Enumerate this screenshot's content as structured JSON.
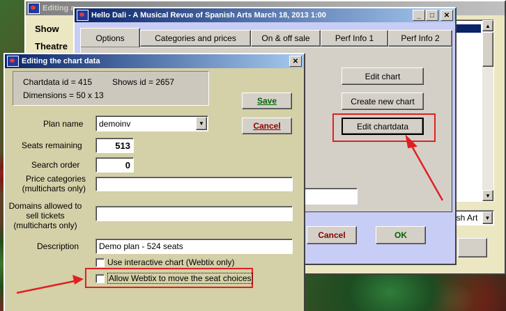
{
  "back_window": {
    "title": "Editing a...",
    "sidebar_items": [
      "Show",
      "Theatre"
    ],
    "dropdown_value": "ish Art"
  },
  "middle_window": {
    "title": "Hello Dali - A Musical Revue of Spanish Arts March 18, 2013 1:00",
    "tabs": [
      "Options",
      "Categories and prices",
      "On & off sale",
      "Perf Info 1",
      "Perf Info 2"
    ],
    "buttons": {
      "edit_chart": "Edit chart",
      "create_new_chart": "Create new chart",
      "edit_chartdata": "Edit chartdata",
      "cancel": "Cancel",
      "ok": "OK"
    }
  },
  "front_window": {
    "title": "Editing the chart data",
    "info": {
      "chartdata_id": "Chartdata id = 415",
      "shows_id": "Shows id = 2657",
      "dimensions": "Dimensions = 50 x 13"
    },
    "labels": {
      "plan_name": "Plan name",
      "seats_remaining": "Seats remaining",
      "search_order": "Search order",
      "price_categories_1": "Price categories",
      "price_categories_2": "(multicharts only)",
      "domains_1": "Domains allowed  to",
      "domains_2": "sell tickets",
      "domains_3": "(multicharts only)",
      "description": "Description"
    },
    "values": {
      "plan_name": "demoinv",
      "seats_remaining": "513",
      "search_order": "0",
      "price_categories": "",
      "domains": "",
      "description": "Demo plan - 524 seats"
    },
    "checkboxes": {
      "interactive_chart": "Use interactive chart (Webtix only)",
      "allow_move": "Allow Webtix to move the seat choices"
    },
    "buttons": {
      "save": "Save",
      "cancel": "Cancel"
    }
  },
  "colors": {
    "highlight": "#e02020",
    "dialog_bg": "#d4d0a8",
    "panel_bg": "#d4d0c8",
    "back_bg": "#ece7c3",
    "frame_blue": "#c8cdf5"
  }
}
